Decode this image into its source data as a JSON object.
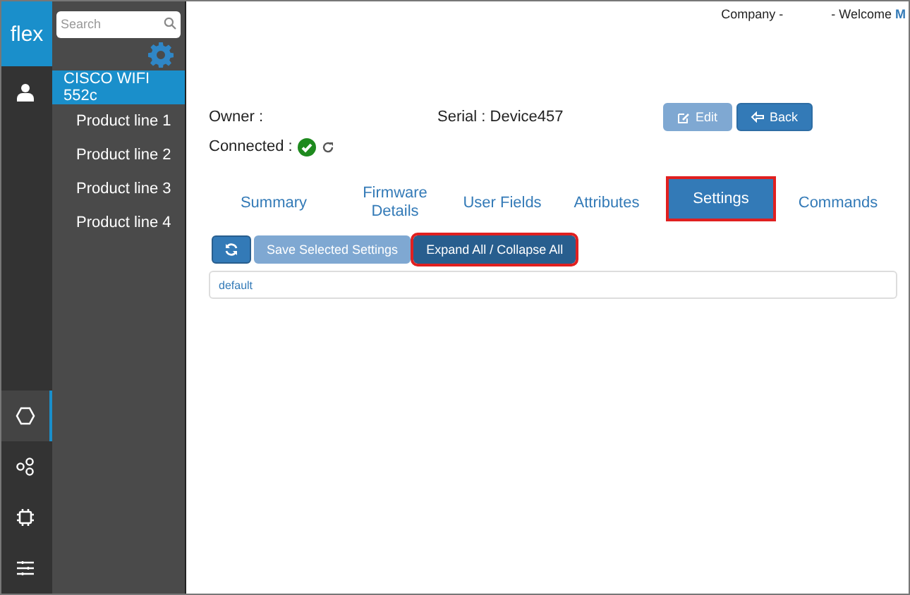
{
  "logo": "flex",
  "rail": [
    {
      "kind": "hexagon",
      "selected": true
    },
    {
      "kind": "nodes",
      "selected": false
    },
    {
      "kind": "chip",
      "selected": false
    },
    {
      "kind": "sliders",
      "selected": false
    }
  ],
  "search": {
    "placeholder": "Search"
  },
  "nav": [
    {
      "label": "CISCO WIFI 552c",
      "selected": true
    },
    {
      "label": "Product line 1",
      "selected": false
    },
    {
      "label": "Product line 2",
      "selected": false
    },
    {
      "label": "Product line 3",
      "selected": false
    },
    {
      "label": "Product line 4",
      "selected": false
    }
  ],
  "header": {
    "company": "Company -",
    "welcome": "- Welcome",
    "user": "M"
  },
  "device": {
    "owner": "Owner :",
    "serial": "Serial : Device457",
    "connected": "Connected :",
    "online": true
  },
  "actions": [
    {
      "label": "Edit",
      "kind": "edit",
      "disabled": true
    },
    {
      "label": "Back",
      "kind": "back",
      "disabled": false
    }
  ],
  "tabs": [
    {
      "label": "Summary",
      "selected": false,
      "highlighted": false
    },
    {
      "label": "Firmware Details",
      "selected": false,
      "highlighted": false
    },
    {
      "label": "User Fields",
      "selected": false,
      "highlighted": false
    },
    {
      "label": "Attributes",
      "selected": false,
      "highlighted": false
    },
    {
      "label": "Settings",
      "selected": true,
      "highlighted": true
    },
    {
      "label": "Commands",
      "selected": false,
      "highlighted": false
    }
  ],
  "toolbar": [
    {
      "kind": "refresh",
      "disabled": false,
      "highlighted": false
    },
    {
      "kind": "text",
      "label": "Save Selected Settings",
      "disabled": true,
      "highlighted": false
    },
    {
      "kind": "text",
      "label": "Expand All / Collapse All",
      "disabled": false,
      "highlighted": true
    }
  ],
  "settings_group": "default"
}
